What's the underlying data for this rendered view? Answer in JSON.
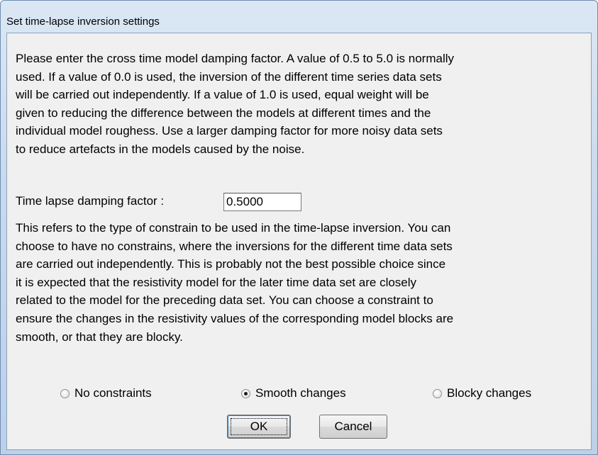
{
  "window": {
    "title": "Set time-lapse inversion settings"
  },
  "description": {
    "damping_text": "Please enter the cross time model damping factor. A value of 0.5 to 5.0  is normally\nused. If a value of 0.0 is used, the inversion of the different time series data sets\nwill be carried out independently. If a value of 1.0 is used, equal weight will be\ngiven to reducing the difference between the models at different times and the\nindividual model roughess. Use a larger damping factor for more noisy data sets\nto reduce artefacts in the models caused by the noise.",
    "constraint_text": "This refers to the type of constrain to be used in the time-lapse inversion. You can\nchoose to have no constrains, where the inversions for the different time data sets\nare carried out independently. This is probably not the best possible choice since\nit is expected that the resistivity model for the later time data set are closely\nrelated to the model for the preceding data set. You can choose a constraint to\nensure the changes in the resistivity values of the corresponding model blocks are\nsmooth, or that they are blocky."
  },
  "damping": {
    "label": "Time lapse damping factor :",
    "value": "0.5000"
  },
  "constraints": {
    "options": [
      {
        "label": "No constraints",
        "selected": false
      },
      {
        "label": "Smooth changes",
        "selected": true
      },
      {
        "label": "Blocky changes",
        "selected": false
      }
    ]
  },
  "buttons": {
    "ok_label": "OK",
    "cancel_label": "Cancel"
  }
}
